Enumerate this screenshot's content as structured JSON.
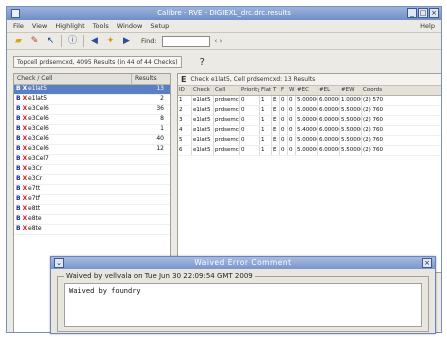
{
  "window": {
    "title": "Calibre - RVE - DIGIEXL_drc.drc.results"
  },
  "menu": {
    "items": [
      "File",
      "View",
      "Highlight",
      "Tools",
      "Window",
      "Setup"
    ],
    "help": "Help"
  },
  "toolbar": {
    "find_label": "Find:",
    "find_value": ""
  },
  "summary": {
    "text": "Topcell prdsemcxd, 4095 Results (in 44 of 44 Checks)"
  },
  "checks": {
    "headers": {
      "name": "Check / Cell",
      "results": "Results"
    },
    "rows": [
      {
        "name": "e1lat5",
        "count": "13"
      },
      {
        "name": "e1lat5",
        "count": "2"
      },
      {
        "name": "e3Cel6",
        "count": "36"
      },
      {
        "name": "e3Cel6",
        "count": "8"
      },
      {
        "name": "e3Cel6",
        "count": "1"
      },
      {
        "name": "e3Cel6",
        "count": "40"
      },
      {
        "name": "e3Cel6",
        "count": "12"
      },
      {
        "name": "e3Cel7",
        "count": ""
      },
      {
        "name": "e3Cr",
        "count": ""
      },
      {
        "name": "e3Cr",
        "count": ""
      },
      {
        "name": "e7tt",
        "count": ""
      },
      {
        "name": "e7tf",
        "count": ""
      },
      {
        "name": "e8tt",
        "count": ""
      },
      {
        "name": "e8te",
        "count": ""
      },
      {
        "name": "e8te",
        "count": ""
      }
    ]
  },
  "results": {
    "title": "Check e1lat5, Cell prdsemcxd: 13 Results",
    "headers": [
      "ID",
      "Check",
      "Cell",
      "Priority",
      "Flat",
      "T",
      "F",
      "W",
      "#EC",
      "#EL",
      "#EW",
      "Coords"
    ],
    "rows": [
      [
        "1",
        "e1lat5",
        "prdsemcxd",
        "0",
        "1",
        "E",
        "0",
        "0",
        "5.00000",
        "6.00000",
        "1.00000",
        "(2) 570"
      ],
      [
        "2",
        "e1lat5",
        "prdsemcxd",
        "0",
        "1",
        "E",
        "0",
        "0",
        "5.00000",
        "6.00000",
        "5.50000",
        "(2) 760"
      ],
      [
        "3",
        "e1lat5",
        "prdsemcxd",
        "0",
        "1",
        "E",
        "0",
        "0",
        "5.00000",
        "6.00000",
        "5.50000",
        "(2) 760"
      ],
      [
        "4",
        "e1lat5",
        "prdsemcxd",
        "0",
        "1",
        "E",
        "0",
        "0",
        "5.40000",
        "6.00000",
        "5.50000",
        "(2) 760"
      ],
      [
        "5",
        "e1lat5",
        "prdsemcxd",
        "0",
        "1",
        "E",
        "0",
        "0",
        "5.00000",
        "6.00000",
        "5.50000",
        "(2) 760"
      ],
      [
        "6",
        "e1lat5",
        "prdsemcxd",
        "0",
        "1",
        "E",
        "0",
        "0",
        "5.00000",
        "6.00000",
        "5.50000",
        "(2) 760"
      ]
    ]
  },
  "dialog": {
    "title": "Waived Error Comment",
    "group_label": "Waived by vellvala on Tue Jun 30 22:09:54 GMT 2009",
    "comment": "Waived by foundry"
  }
}
